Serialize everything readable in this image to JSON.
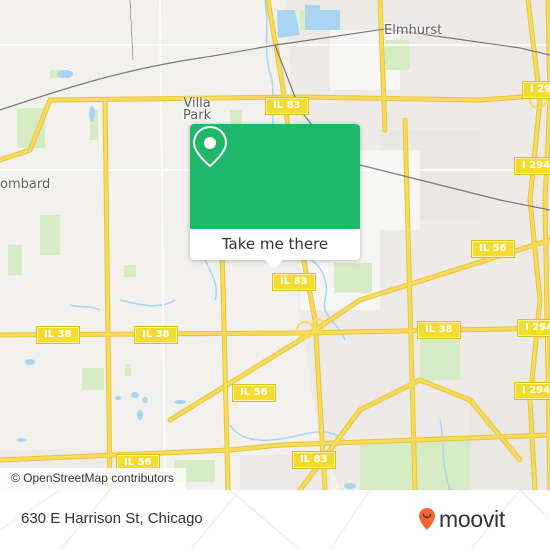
{
  "map": {
    "places": [
      {
        "id": "elmhurst",
        "name": "Elmhurst"
      },
      {
        "id": "villa-park",
        "name": "Villa\nPark"
      },
      {
        "id": "lombard",
        "name": "ombard"
      }
    ],
    "shields": [
      {
        "id": "il83-top",
        "label": "IL 83"
      },
      {
        "id": "i294-top",
        "label": "I 29"
      },
      {
        "id": "i294-upper",
        "label": "I 294"
      },
      {
        "id": "il56-right",
        "label": "IL 56"
      },
      {
        "id": "il83-mid",
        "label": "IL 83"
      },
      {
        "id": "il38-left",
        "label": "IL 38"
      },
      {
        "id": "il38-mid",
        "label": "IL 38"
      },
      {
        "id": "il38-right",
        "label": "IL 38"
      },
      {
        "id": "i294-mid",
        "label": "I 294"
      },
      {
        "id": "il56-center",
        "label": "IL 56"
      },
      {
        "id": "i294-lower",
        "label": "I 294"
      },
      {
        "id": "il56-bottom",
        "label": "IL 56"
      },
      {
        "id": "il83-bottom",
        "label": "IL 83"
      }
    ],
    "attribution": "© OpenStreetMap contributors",
    "colors": {
      "land": "#f2f1ee",
      "urban": "#e9e4e1",
      "park": "#d7ebc4",
      "water": "#a9d5f0",
      "road": "#f7dc5c",
      "road_casing": "#e8c53a",
      "rail": "#7a7a7a"
    }
  },
  "popup": {
    "icon": "location-pin-icon",
    "button_label": "Take me there",
    "color": "#1fb86a"
  },
  "footer": {
    "address": "630 E Harrison St, Chicago",
    "brand": "moovit",
    "brand_color": "#f26430"
  }
}
